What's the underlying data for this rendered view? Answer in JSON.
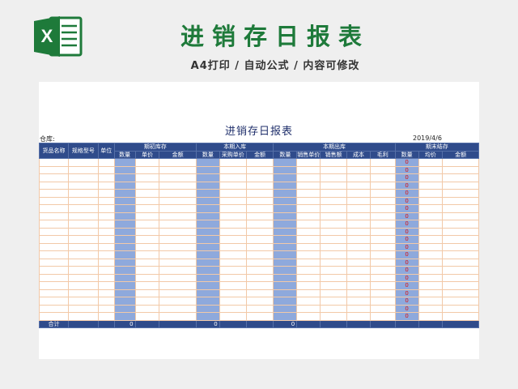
{
  "banner": {
    "title": "进销存日报表",
    "subtitle": "A4打印 / 自动公式 / 内容可修改",
    "logo_icon": "excel-icon",
    "logo_letter": "X"
  },
  "sheet": {
    "title": "进销存日报表",
    "warehouse_label": "仓库:",
    "date": "2019/4/6",
    "headers": {
      "item_name": "货品名称",
      "model": "规格型号",
      "unit": "单位",
      "groups": [
        "期初库存",
        "本期入库",
        "本期出库",
        "期末结存"
      ],
      "sub": [
        "数量",
        "单价",
        "金额",
        "数量",
        "采购单价",
        "金额",
        "数量",
        "销售单价",
        "销售额",
        "成本",
        "毛利",
        "数量",
        "均价",
        "金额"
      ]
    },
    "closing_qty_values": [
      "0",
      "0",
      "0",
      "0",
      "0",
      "0",
      "0",
      "0",
      "0",
      "0",
      "0",
      "0",
      "0",
      "0",
      "0",
      "0",
      "0",
      "0",
      "0",
      "0",
      "0"
    ],
    "total": {
      "label": "合计",
      "opening_qty": "0",
      "inbound_qty": "0",
      "outbound_qty": "0"
    }
  },
  "colors": {
    "header_bg": "#2f4b8b",
    "qty_col": "#8ea9dc",
    "grid_line": "#f2c9a8",
    "banner_green": "#1e7a3a",
    "zero_red": "#d11"
  }
}
